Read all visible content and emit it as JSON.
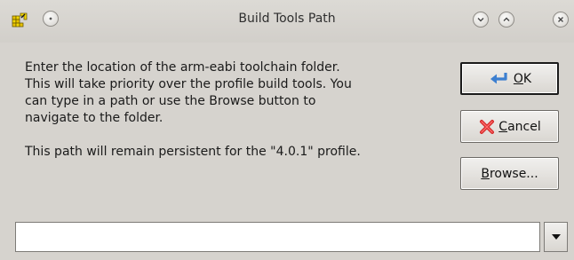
{
  "window": {
    "title": "Build Tools Path"
  },
  "message": {
    "line1": "Enter the location of the arm-eabi toolchain folder.",
    "line2": "This will take priority over the profile build tools. You",
    "line3": "can type in a path or use the Browse button to",
    "line4": "navigate to the folder.",
    "persistent": "This path will remain persistent for the \"4.0.1\" profile."
  },
  "buttons": {
    "ok": {
      "mnemonic": "O",
      "rest": "K"
    },
    "cancel": {
      "mnemonic": "C",
      "rest": "ancel"
    },
    "browse": {
      "mnemonic": "B",
      "rest": "rowse..."
    }
  },
  "path_combo": {
    "value": ""
  },
  "icons": {
    "app": "build-folder-icon",
    "ok": "enter-arrow-icon",
    "cancel": "red-x-icon",
    "dropdown": "triangle-down-icon"
  },
  "colors": {
    "window_bg": "#d6d3ce",
    "cancel_icon": "#d42a2a",
    "ok_icon": "#3c7fd0"
  }
}
